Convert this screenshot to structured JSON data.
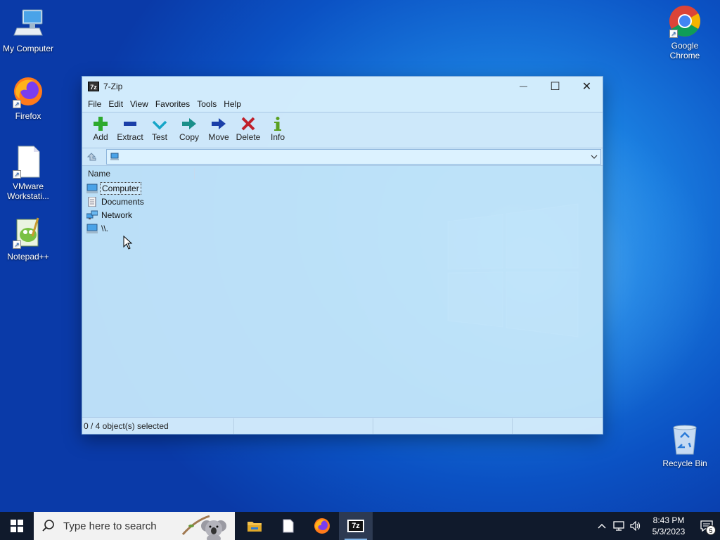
{
  "desktop": {
    "icons": [
      {
        "label": "My Computer",
        "icon": "computer-icon"
      },
      {
        "label": "Firefox",
        "icon": "firefox-icon"
      },
      {
        "label": "VMware Workstati...",
        "icon": "document-icon"
      },
      {
        "label": "Notepad++",
        "icon": "notepad-plus-plus-icon"
      },
      {
        "label": "Google Chrome",
        "icon": "chrome-icon"
      },
      {
        "label": "Recycle Bin",
        "icon": "recycle-bin-icon"
      }
    ]
  },
  "window": {
    "title": "7-Zip",
    "logo_text": "7z",
    "controls": {
      "minimize": "—",
      "maximize": "☐",
      "close": "✕"
    },
    "menu": [
      "File",
      "Edit",
      "View",
      "Favorites",
      "Tools",
      "Help"
    ],
    "toolbar": [
      {
        "label": "Add",
        "icon": "add-icon",
        "color": "#2eaa2e"
      },
      {
        "label": "Extract",
        "icon": "extract-icon",
        "color": "#1a3fa8"
      },
      {
        "label": "Test",
        "icon": "test-icon",
        "color": "#16a5c8"
      },
      {
        "label": "Copy",
        "icon": "copy-icon",
        "color": "#1a8f8a"
      },
      {
        "label": "Move",
        "icon": "move-icon",
        "color": "#1a3fa8"
      },
      {
        "label": "Delete",
        "icon": "delete-icon",
        "color": "#c0202a"
      },
      {
        "label": "Info",
        "icon": "info-icon",
        "color": "#5aa020"
      }
    ],
    "address": {
      "value": ""
    },
    "columns": {
      "name": "Name"
    },
    "files": [
      {
        "name": "Computer",
        "icon": "computer-icon"
      },
      {
        "name": "Documents",
        "icon": "documents-icon"
      },
      {
        "name": "Network",
        "icon": "network-icon"
      },
      {
        "name": "\\\\.",
        "icon": "computer-icon"
      }
    ],
    "status": {
      "selection": "0 / 4 object(s) selected",
      "cell2": "",
      "cell3": ""
    }
  },
  "taskbar": {
    "search_placeholder": "Type here to search",
    "apps": [
      {
        "name": "file-explorer",
        "icon": "folder-icon"
      },
      {
        "name": "notepad",
        "icon": "document-icon"
      },
      {
        "name": "firefox",
        "icon": "firefox-icon"
      },
      {
        "name": "7-zip",
        "icon": "7zip-icon",
        "text": "7z"
      }
    ],
    "clock": {
      "time": "8:43 PM",
      "date": "5/3/2023"
    },
    "notification_count": "5"
  }
}
